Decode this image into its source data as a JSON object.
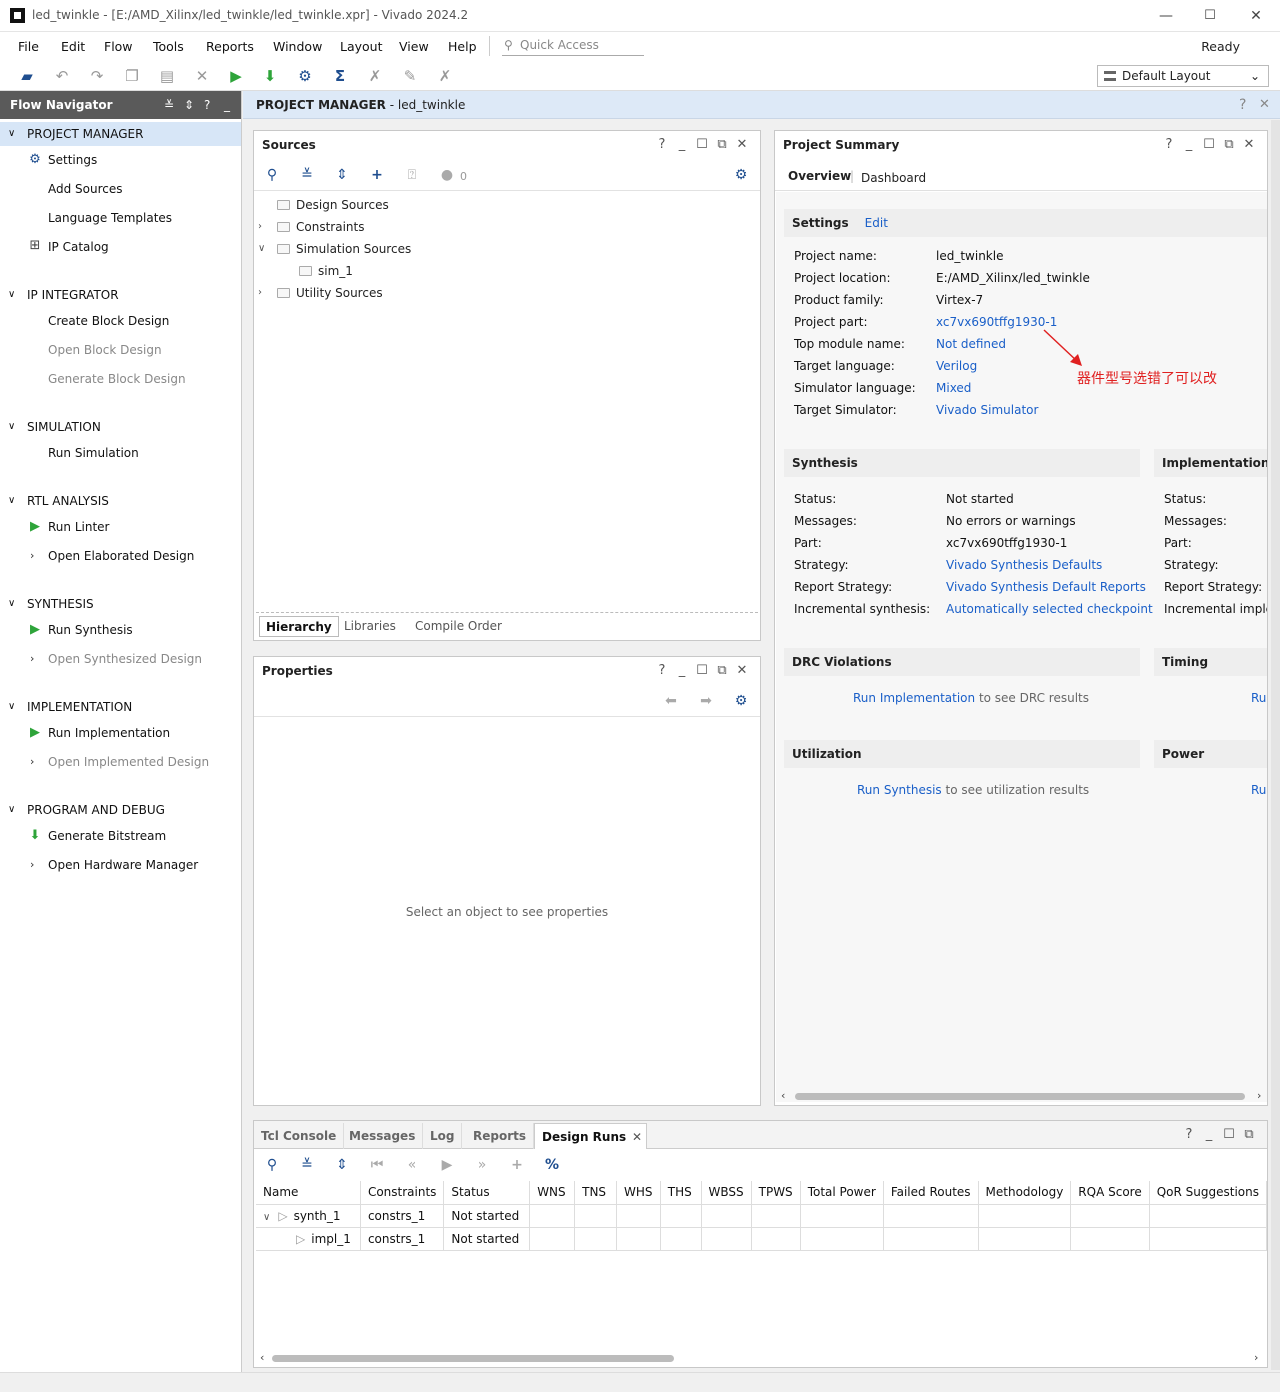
{
  "window": {
    "title": "led_twinkle - [E:/AMD_Xilinx/led_twinkle/led_twinkle.xpr] - Vivado 2024.2",
    "minimize": "—",
    "maximize": "☐",
    "close": "✕"
  },
  "menu": [
    "File",
    "Edit",
    "Flow",
    "Tools",
    "Reports",
    "Window",
    "Layout",
    "View",
    "Help"
  ],
  "quick_access": {
    "placeholder": "Quick Access",
    "icon": "search-icon"
  },
  "status": "Ready",
  "layout_select": {
    "value": "Default Layout"
  },
  "toolbar_icons": [
    "open-project-icon",
    "undo-icon",
    "redo-icon",
    "copy-icon",
    "paste-icon",
    "delete-icon",
    "run-icon",
    "generate-bitstream-icon",
    "settings-icon",
    "sigma-icon",
    "disabled-icon-1",
    "disabled-icon-2",
    "disabled-icon-3"
  ],
  "flow_navigator": {
    "title": "Flow Navigator",
    "sections": [
      {
        "title": "PROJECT MANAGER",
        "items": [
          "Settings",
          "Add Sources",
          "Language Templates",
          "IP Catalog"
        ]
      },
      {
        "title": "IP INTEGRATOR",
        "items": [
          "Create Block Design",
          "Open Block Design",
          "Generate Block Design"
        ]
      },
      {
        "title": "SIMULATION",
        "items": [
          "Run Simulation"
        ]
      },
      {
        "title": "RTL ANALYSIS",
        "items": [
          "Run Linter",
          "Open Elaborated Design"
        ]
      },
      {
        "title": "SYNTHESIS",
        "items": [
          "Run Synthesis",
          "Open Synthesized Design"
        ]
      },
      {
        "title": "IMPLEMENTATION",
        "items": [
          "Run Implementation",
          "Open Implemented Design"
        ]
      },
      {
        "title": "PROGRAM AND DEBUG",
        "items": [
          "Generate Bitstream",
          "Open Hardware Manager"
        ]
      }
    ]
  },
  "pm_bar": {
    "title_bold": "PROJECT MANAGER",
    "title_rest": " - led_twinkle"
  },
  "sources": {
    "title": "Sources",
    "count": "0",
    "tree": [
      "Design Sources",
      "Constraints",
      "Simulation Sources",
      "sim_1",
      "Utility Sources"
    ],
    "tabs": [
      "Hierarchy",
      "Libraries",
      "Compile Order"
    ]
  },
  "properties": {
    "title": "Properties",
    "empty_text": "Select an object to see properties"
  },
  "project_summary": {
    "title": "Project Summary",
    "tabs": [
      "Overview",
      "Dashboard"
    ],
    "settings": {
      "title": "Settings",
      "edit": "Edit",
      "rows": [
        {
          "label": "Project name:",
          "value": "led_twinkle"
        },
        {
          "label": "Project location:",
          "value": "E:/AMD_Xilinx/led_twinkle"
        },
        {
          "label": "Product family:",
          "value": "Virtex-7"
        },
        {
          "label": "Project part:",
          "value": "xc7vx690tffg1930-1"
        },
        {
          "label": "Top module name:",
          "value": "Not defined"
        },
        {
          "label": "Target language:",
          "value": "Verilog"
        },
        {
          "label": "Simulator language:",
          "value": "Mixed"
        },
        {
          "label": "Target Simulator:",
          "value": "Vivado Simulator"
        }
      ]
    },
    "annotation": "器件型号选错了可以改",
    "synthesis": {
      "title": "Synthesis",
      "rows": [
        {
          "label": "Status:",
          "value": "Not started"
        },
        {
          "label": "Messages:",
          "value": "No errors or warnings"
        },
        {
          "label": "Part:",
          "value": "xc7vx690tffg1930-1"
        },
        {
          "label": "Strategy:",
          "value": "Vivado Synthesis Defaults"
        },
        {
          "label": "Report Strategy:",
          "value": "Vivado Synthesis Default Reports"
        },
        {
          "label": "Incremental synthesis:",
          "value": "Automatically selected checkpoint"
        }
      ]
    },
    "implementation": {
      "title": "Implementation",
      "rows": [
        "Status:",
        "Messages:",
        "Part:",
        "Strategy:",
        "Report Strategy:",
        "Incremental implen"
      ]
    },
    "drc": {
      "title": "DRC Violations",
      "link": "Run Implementation",
      "rest": "to see DRC results"
    },
    "timing": {
      "title": "Timing",
      "link": "Ru"
    },
    "utilization": {
      "title": "Utilization",
      "link": "Run Synthesis",
      "rest": "to see utilization results"
    },
    "power": {
      "title": "Power",
      "link": "Ru"
    }
  },
  "bottom": {
    "tabs": [
      "Tcl Console",
      "Messages",
      "Log",
      "Reports",
      "Design Runs"
    ],
    "active_close": "✕",
    "columns": [
      "Name",
      "Constraints",
      "Status",
      "WNS",
      "TNS",
      "WHS",
      "THS",
      "WBSS",
      "TPWS",
      "Total Power",
      "Failed Routes",
      "Methodology",
      "RQA Score",
      "QoR Suggestions"
    ],
    "rows": [
      {
        "name": "synth_1",
        "constraints": "constrs_1",
        "status": "Not started"
      },
      {
        "name": "impl_1",
        "constraints": "constrs_1",
        "status": "Not started"
      }
    ]
  },
  "colors": {
    "accent": "#1a5fc8",
    "run_green": "#2ea43a",
    "nav_header": "#5a5a5a",
    "selected": "#d7e6f7",
    "annotation": "#e02020"
  }
}
